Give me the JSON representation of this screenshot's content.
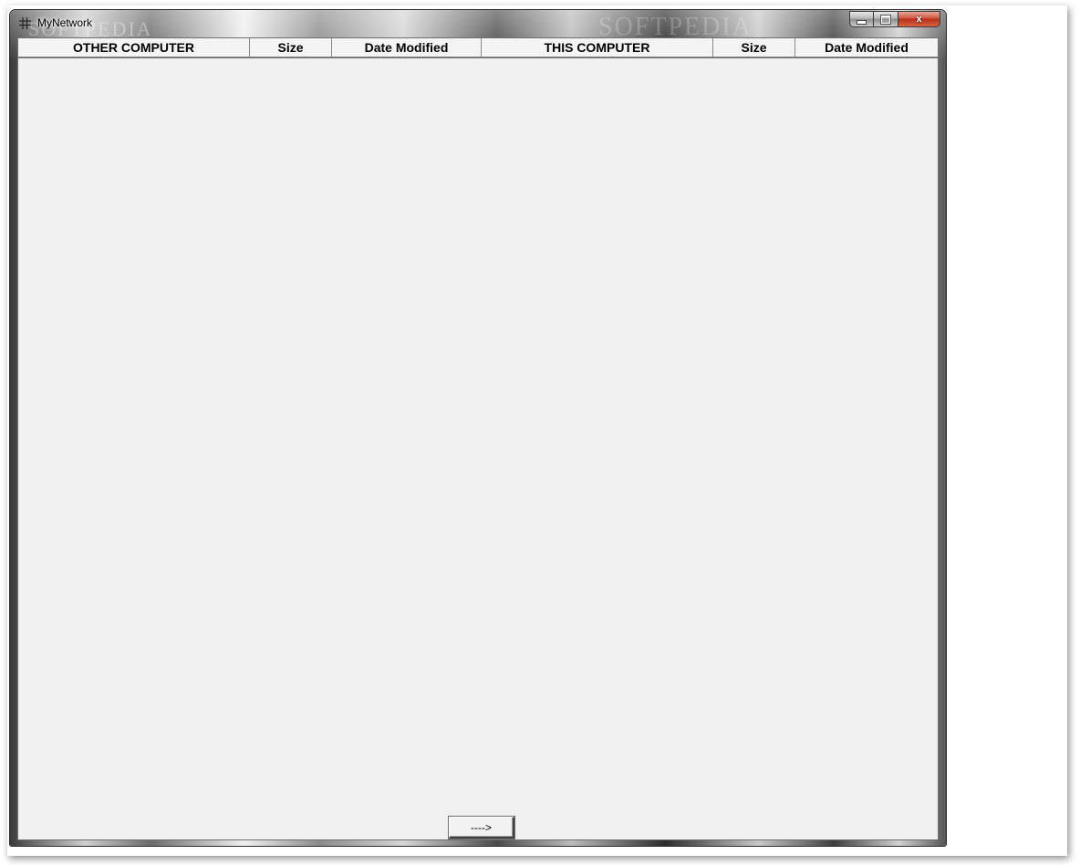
{
  "window": {
    "title": "MyNetwork",
    "watermark_left": "SOFTPEDIA",
    "watermark_right": "SOFTPEDIA",
    "controls": {
      "minimize_icon": "minimize-icon",
      "maximize_icon": "maximize-icon",
      "close_label": "x"
    }
  },
  "table_header": {
    "columns": [
      "OTHER COMPUTER",
      "Size",
      "Date Modified",
      "THIS COMPUTER",
      "Size",
      "Date Modified"
    ]
  },
  "other_computer_rows": [],
  "this_computer_rows": [],
  "transfer_button_label": "---->",
  "colors": {
    "client_bg": "#f0f0f0",
    "close_button": "#c8412b"
  }
}
